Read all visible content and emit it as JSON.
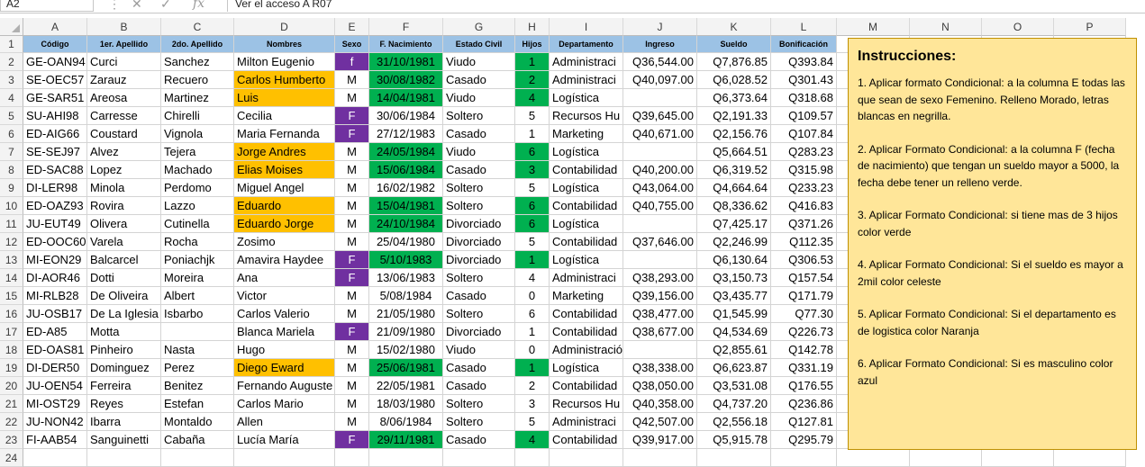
{
  "formula_bar": {
    "name_box": "A2",
    "formula": "Ver el acceso A R07"
  },
  "columns": [
    "A",
    "B",
    "C",
    "D",
    "E",
    "F",
    "G",
    "H",
    "I",
    "J",
    "K",
    "L",
    "M",
    "N",
    "O",
    "P"
  ],
  "table": {
    "headers": [
      "Código",
      "1er. Apellido",
      "2do. Apellido",
      "Nombres",
      "Sexo",
      "F. Nacimiento",
      "Estado Civil",
      "Hijos",
      "Departamento",
      "Ingreso",
      "Sueldo",
      "Bonificación"
    ],
    "rows": [
      [
        "GE-OAN94",
        "Curci",
        "Sanchez",
        "Milton Eugenio",
        "f",
        "31/10/1981",
        "Viudo",
        "1",
        "Administraci",
        "Q36,544.00",
        "Q7,876.85",
        "Q393.84"
      ],
      [
        "SE-OEC57",
        "Zarauz",
        "Recuero",
        "Carlos Humberto",
        "M",
        "30/08/1982",
        "Casado",
        "2",
        "Administraci",
        "Q40,097.00",
        "Q6,028.52",
        "Q301.43"
      ],
      [
        "GE-SAR51",
        "Areosa",
        "Martinez",
        "Luis",
        "M",
        "14/04/1981",
        "Viudo",
        "4",
        "Logística",
        "",
        "Q6,373.64",
        "Q318.68"
      ],
      [
        "SU-AHI98",
        "Carresse",
        "Chirelli",
        "Cecilia",
        "F",
        "30/06/1984",
        "Soltero",
        "5",
        "Recursos Hu",
        "Q39,645.00",
        "Q2,191.33",
        "Q109.57"
      ],
      [
        "ED-AIG66",
        "Coustard",
        "Vignola",
        "Maria Fernanda",
        "F",
        "27/12/1983",
        "Casado",
        "1",
        "Marketing",
        "Q40,671.00",
        "Q2,156.76",
        "Q107.84"
      ],
      [
        "SE-SEJ97",
        "Alvez",
        "Tejera",
        "Jorge Andres",
        "M",
        "24/05/1984",
        "Viudo",
        "6",
        "Logística",
        "",
        "Q5,664.51",
        "Q283.23"
      ],
      [
        "ED-SAC88",
        "Lopez",
        "Machado",
        "Elias Moises",
        "M",
        "15/06/1984",
        "Casado",
        "3",
        "Contabilidad",
        "Q40,200.00",
        "Q6,319.52",
        "Q315.98"
      ],
      [
        "DI-LER98",
        "Minola",
        "Perdomo",
        "Miguel Angel",
        "M",
        "16/02/1982",
        "Soltero",
        "5",
        "Logística",
        "Q43,064.00",
        "Q4,664.64",
        "Q233.23"
      ],
      [
        "ED-OAZ93",
        "Rovira",
        "Lazzo",
        "Eduardo",
        "M",
        "15/04/1981",
        "Soltero",
        "6",
        "Contabilidad",
        "Q40,755.00",
        "Q8,336.62",
        "Q416.83"
      ],
      [
        "JU-EUT49",
        "Olivera",
        "Cutinella",
        "Eduardo Jorge",
        "M",
        "24/10/1984",
        "Divorciado",
        "6",
        "Logística",
        "",
        "Q7,425.17",
        "Q371.26"
      ],
      [
        "ED-OOC60",
        "Varela",
        "Rocha",
        "Zosimo",
        "M",
        "25/04/1980",
        "Divorciado",
        "5",
        "Contabilidad",
        "Q37,646.00",
        "Q2,246.99",
        "Q112.35"
      ],
      [
        "MI-EON29",
        "Balcarcel",
        "Poniachjk",
        "Amavira Haydee",
        "F",
        "5/10/1983",
        "Divorciado",
        "1",
        "Logística",
        "",
        "Q6,130.64",
        "Q306.53"
      ],
      [
        "DI-AOR46",
        "Dotti",
        "Moreira",
        "Ana",
        "F",
        "13/06/1983",
        "Soltero",
        "4",
        "Administraci",
        "Q38,293.00",
        "Q3,150.73",
        "Q157.54"
      ],
      [
        "MI-RLB28",
        "De Oliveira",
        "Albert",
        "Victor",
        "M",
        "5/08/1984",
        "Casado",
        "0",
        "Marketing",
        "Q39,156.00",
        "Q3,435.77",
        "Q171.79"
      ],
      [
        "JU-OSB17",
        "De La Iglesia",
        "Isbarbo",
        "Carlos Valerio",
        "M",
        "21/05/1980",
        "Soltero",
        "6",
        "Contabilidad",
        "Q38,477.00",
        "Q1,545.99",
        "Q77.30"
      ],
      [
        "ED-A85",
        "Motta",
        "",
        "Blanca Mariela",
        "F",
        "21/09/1980",
        "Divorciado",
        "1",
        "Contabilidad",
        "Q38,677.00",
        "Q4,534.69",
        "Q226.73"
      ],
      [
        "ED-OAS81",
        "Pinheiro",
        "Nasta",
        "Hugo",
        "M",
        "15/02/1980",
        "Viudo",
        "0",
        "Administración",
        "",
        "Q2,855.61",
        "Q142.78"
      ],
      [
        "DI-DER50",
        "Dominguez",
        "Perez",
        "Diego Eward",
        "M",
        "25/06/1981",
        "Casado",
        "1",
        "Logística",
        "Q38,338.00",
        "Q6,623.87",
        "Q331.19"
      ],
      [
        "JU-OEN54",
        "Ferreira",
        "Benitez",
        "Fernando Auguste",
        "M",
        "22/05/1981",
        "Casado",
        "2",
        "Contabilidad",
        "Q38,050.00",
        "Q3,531.08",
        "Q176.55"
      ],
      [
        "MI-OST29",
        "Reyes",
        "Estefan",
        "Carlos Mario",
        "M",
        "18/03/1980",
        "Soltero",
        "3",
        "Recursos Hu",
        "Q40,358.00",
        "Q4,737.20",
        "Q236.86"
      ],
      [
        "JU-NON42",
        "Ibarra",
        "Montaldo",
        "Allen",
        "M",
        "8/06/1984",
        "Soltero",
        "5",
        "Administraci",
        "Q42,507.00",
        "Q2,556.18",
        "Q127.81"
      ],
      [
        "FI-AAB54",
        "Sanguinetti",
        "Cabaña",
        "Lucía María",
        "F",
        "29/11/1981",
        "Casado",
        "4",
        "Contabilidad",
        "Q39,917.00",
        "Q5,915.78",
        "Q295.79"
      ]
    ]
  },
  "fills": {
    "orange": "#ffc000",
    "green": "#00b050",
    "purple": "#7030a0",
    "header_blue": "#9cc2e5",
    "note_yellow": "#ffe699"
  },
  "instructions": {
    "title": "Instrucciones:",
    "items": [
      "1. Aplicar formato Condicional: a la columna E todas las que sean de sexo Femenino. Relleno Morado, letras blancas en negrilla.",
      "2. Aplicar Formato Condicional:  a la columna F (fecha de nacimiento) que tengan un sueldo mayor a 5000, la fecha debe tener un relleno verde.",
      "3. Aplicar Formato Condicional: si tiene mas de 3 hijos color verde",
      "4. Aplicar Formato Condicional: Si el sueldo es mayor a 2mil color celeste",
      "5. Aplicar Formato Condicional: Si el departamento es de logistica color Naranja",
      "6. Aplicar Formato Condicional: Si es masculino color azul"
    ]
  }
}
